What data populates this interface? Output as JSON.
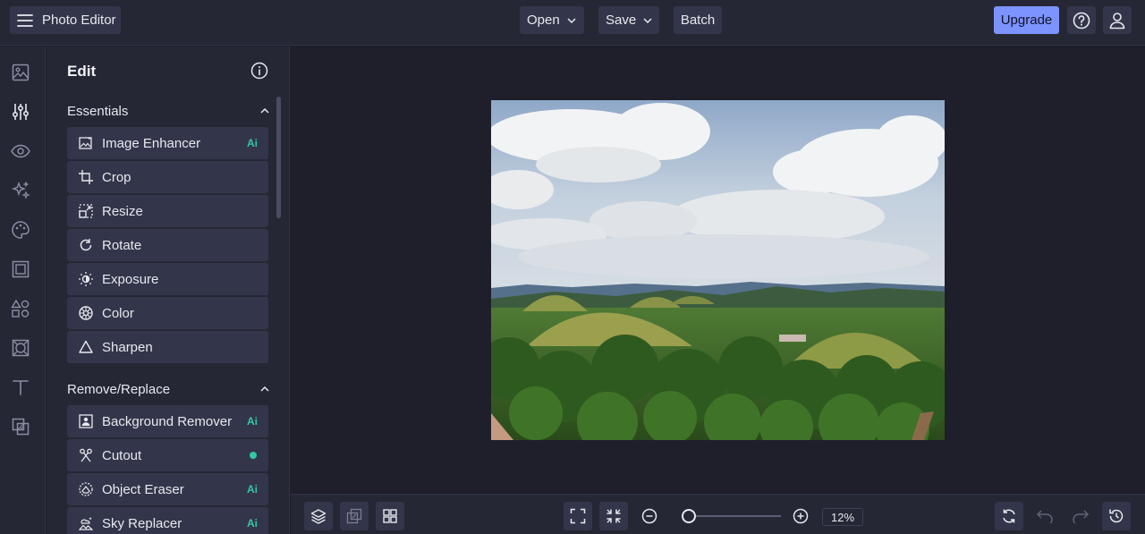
{
  "app": {
    "title": "Photo Editor"
  },
  "header": {
    "menus": {
      "open": "Open",
      "save": "Save",
      "batch": "Batch"
    },
    "upgrade": "Upgrade",
    "icons": {
      "menu": "hamburger-icon",
      "help": "question-circle-icon",
      "account": "user-icon"
    }
  },
  "rail": {
    "items": [
      "image-icon",
      "sliders-icon",
      "eye-icon",
      "sparkles-icon",
      "palette-icon",
      "frame-icon",
      "shapes-icon",
      "texture-icon",
      "text-icon",
      "overlay-icon"
    ],
    "active": "sliders-icon"
  },
  "panel": {
    "title": "Edit",
    "sections": [
      {
        "title": "Essentials",
        "tools": [
          {
            "label": "Image Enhancer",
            "icon": "image-enhancer-icon",
            "badge": "Ai"
          },
          {
            "label": "Crop",
            "icon": "crop-icon",
            "badge": ""
          },
          {
            "label": "Resize",
            "icon": "resize-icon",
            "badge": ""
          },
          {
            "label": "Rotate",
            "icon": "rotate-icon",
            "badge": ""
          },
          {
            "label": "Exposure",
            "icon": "sun-icon",
            "badge": ""
          },
          {
            "label": "Color",
            "icon": "color-wheel-icon",
            "badge": ""
          },
          {
            "label": "Sharpen",
            "icon": "triangle-icon",
            "badge": ""
          }
        ]
      },
      {
        "title": "Remove/Replace",
        "tools": [
          {
            "label": "Background Remover",
            "icon": "background-remover-icon",
            "badge": "Ai"
          },
          {
            "label": "Cutout",
            "icon": "scissors-icon",
            "badge": "dot"
          },
          {
            "label": "Object Eraser",
            "icon": "eraser-icon",
            "badge": "Ai"
          },
          {
            "label": "Sky Replacer",
            "icon": "sky-replacer-icon",
            "badge": "Ai"
          }
        ]
      }
    ]
  },
  "bottom": {
    "zoom_percent": 12,
    "zoom_value": "12",
    "zoom_unit": "%"
  },
  "colors": {
    "accent": "#7d93ff",
    "ai_badge": "#34c7a4",
    "background": "#1e1f2b",
    "panel": "#252735"
  }
}
